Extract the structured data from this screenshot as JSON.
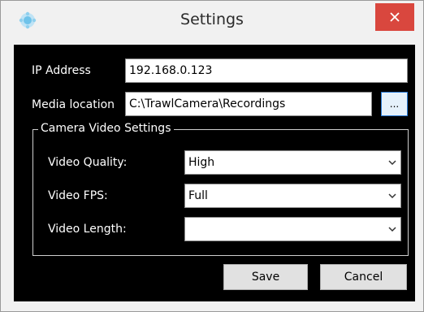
{
  "window": {
    "title": "Settings",
    "app_icon": "app-logo-icon",
    "close_icon": "close-icon",
    "close_color": "#d9473e"
  },
  "form": {
    "ip_address": {
      "label": "IP Address",
      "value": "192.168.0.123"
    },
    "media_location": {
      "label": "Media location",
      "value": "C:\\TrawlCamera\\Recordings",
      "browse_label": "..."
    }
  },
  "camera_group": {
    "title": "Camera Video Settings",
    "video_quality": {
      "label": "Video Quality:",
      "value": "High"
    },
    "video_fps": {
      "label": "Video FPS:",
      "value": "Full"
    },
    "video_length": {
      "label": "Video Length:",
      "value": ""
    },
    "dropdown_icon": "chevron-down-icon"
  },
  "buttons": {
    "save": "Save",
    "cancel": "Cancel"
  },
  "colors": {
    "client_background": "#000000",
    "accent": "#2a7cd6"
  }
}
